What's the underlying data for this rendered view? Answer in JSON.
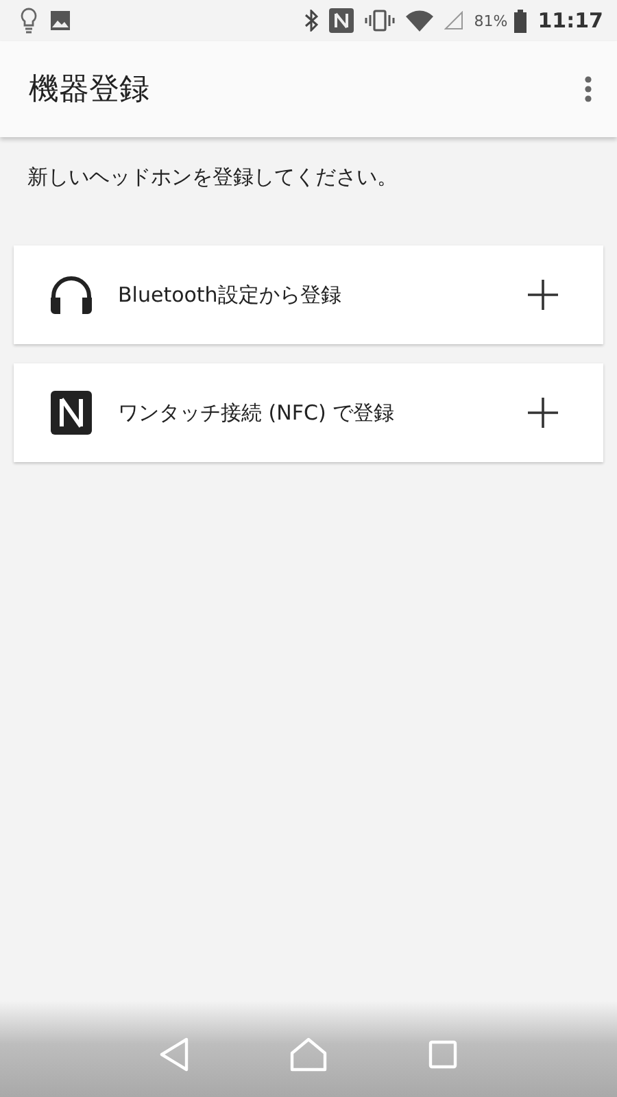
{
  "status_bar": {
    "battery": "81%",
    "time": "11:17"
  },
  "app_bar": {
    "title": "機器登録"
  },
  "message": "新しいヘッドホンを登録してください。",
  "options": [
    {
      "kind": "headphones",
      "label": "Bluetooth設定から登録"
    },
    {
      "kind": "nfc",
      "label": "ワンタッチ接続 (NFC) で登録"
    }
  ]
}
